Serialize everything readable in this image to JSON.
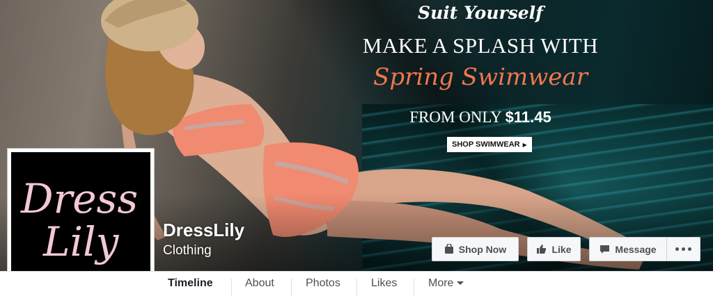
{
  "cover": {
    "promo": {
      "script_line": "Suit Yourself",
      "headline": "MAKE A SPLASH WITH",
      "accent_line": "Spring Swimwear",
      "price_prefix": "FROM ONLY",
      "price": "$11.45",
      "cta_label": "SHOP SWIMWEAR"
    },
    "colors": {
      "accent": "#f0774e",
      "water": "#0b3739",
      "swimsuit": "#f08a70"
    }
  },
  "profile": {
    "logo_line_1": "Dress",
    "logo_line_2": "Lily",
    "logo_color": "#f2c9d3",
    "page_name": "DressLily",
    "category": "Clothing"
  },
  "actions": {
    "shop_now": {
      "label": "Shop Now",
      "icon": "shopping-bag-icon"
    },
    "like": {
      "label": "Like",
      "icon": "thumbs-up-icon"
    },
    "message": {
      "label": "Message",
      "icon": "chat-bubble-icon"
    },
    "more": {
      "icon": "more-dots-icon"
    }
  },
  "nav": {
    "tabs": [
      {
        "label": "Timeline",
        "active": true
      },
      {
        "label": "About",
        "active": false
      },
      {
        "label": "Photos",
        "active": false
      },
      {
        "label": "Likes",
        "active": false
      },
      {
        "label": "More",
        "active": false,
        "icon": "caret-down-icon"
      }
    ]
  }
}
